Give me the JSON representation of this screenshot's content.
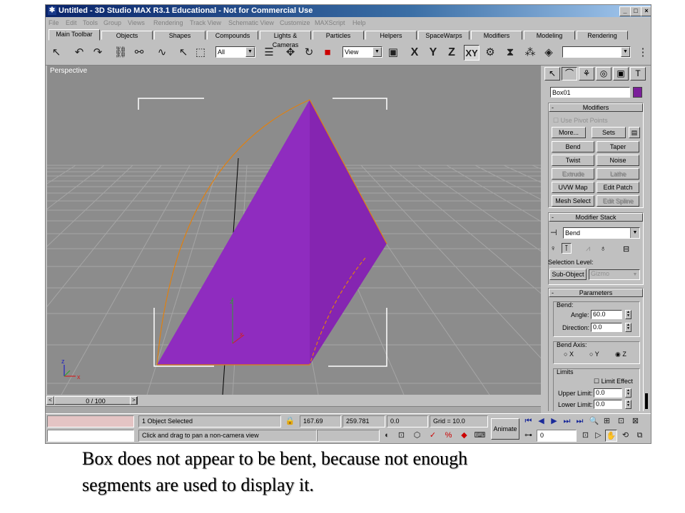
{
  "window": {
    "title": "Untitled - 3D Studio MAX R3.1 Educational - Not for Commercial Use",
    "icon": "max-logo-icon",
    "buttons": [
      "_",
      "□",
      "×"
    ]
  },
  "menu": [
    "File",
    "Edit",
    "Tools",
    "Group",
    "Views",
    "Rendering",
    "Track View",
    "Schematic View",
    "Customize",
    "MAXScript",
    "Help"
  ],
  "tabs": [
    "Main Toolbar",
    "Objects",
    "Shapes",
    "Compounds",
    "Lights & Cameras",
    "Particles",
    "Helpers",
    "SpaceWarps",
    "Modifiers",
    "Modeling",
    "Rendering"
  ],
  "toolbar": {
    "selection_filter": "All",
    "ref_coord": "View",
    "axis_x": "X",
    "axis_y": "Y",
    "axis_z": "Z",
    "axis_xy": "XY",
    "named_sel": ""
  },
  "viewport": {
    "label": "Perspective",
    "gizmo_z": "z",
    "gizmo_x": "x",
    "axis_z": "z",
    "axis_x": "x"
  },
  "timeslider": {
    "frame": "0 / 100",
    "prev": "<",
    "next": ">"
  },
  "command_panel": {
    "object_name": "Box01",
    "object_color": "#7a1f9a",
    "modifiers": {
      "title": "Modifiers",
      "use_pivot": "Use Pivot Points",
      "more": "More...",
      "sets": "Sets",
      "buttons": [
        "Bend",
        "Taper",
        "Twist",
        "Noise",
        "Extrude",
        "Lathe",
        "UVW Map",
        "Edit Patch",
        "Mesh Select",
        "Edit Spline"
      ]
    },
    "stack": {
      "title": "Modifier Stack",
      "current": "Bend",
      "selection_level": "Selection Level:",
      "sub_object": "Sub-Object",
      "gizmo": "Gizmo"
    },
    "parameters": {
      "title": "Parameters",
      "bend_group": "Bend:",
      "angle_label": "Angle:",
      "angle": "60.0",
      "direction_label": "Direction:",
      "direction": "0.0",
      "axis_group": "Bend Axis:",
      "axis_x": "X",
      "axis_y": "Y",
      "axis_z": "Z",
      "limits_group": "Limits",
      "limit_effect": "Limit Effect",
      "upper_label": "Upper Limit:",
      "upper": "0.0",
      "lower_label": "Lower Limit:",
      "lower": "0.0"
    }
  },
  "status": {
    "selected": "1 Object Selected",
    "prompt": "Click and drag to pan a non-camera view",
    "x": "167.69",
    "y": "259.781",
    "z": "0.0",
    "grid": "Grid = 10.0",
    "animate": "Animate",
    "frame_field": "0"
  },
  "caption": {
    "line1": "Box does not appear to be bent, because not enough",
    "line2": "segments are used to display it."
  }
}
